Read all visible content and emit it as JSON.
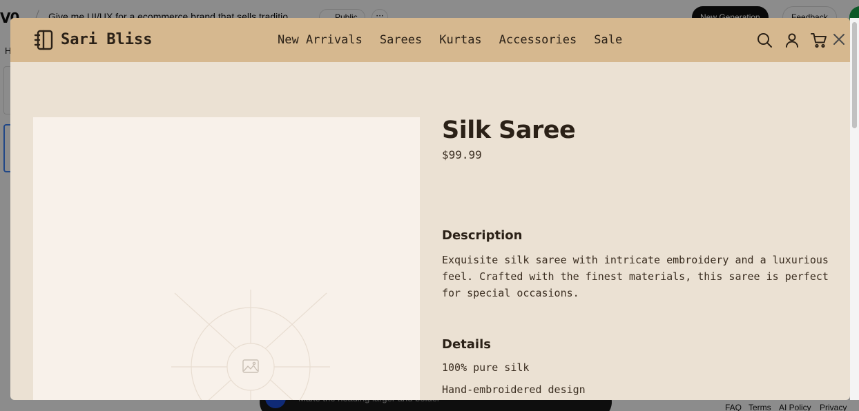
{
  "background": {
    "prompt_text": "Give me UI/UX for a ecommerce brand that sells traditio",
    "public_label": "Public",
    "more_label": "···",
    "new_generation_label": "New Generation",
    "feedback_label": "Feedback",
    "partial_text": "H",
    "chat_placeholder": "Make the heading larger and bolder",
    "footer": [
      "FAQ",
      "Terms",
      "AI Policy",
      "Privacy"
    ]
  },
  "header": {
    "brand_name": "Sari Bliss",
    "nav": [
      "New Arrivals",
      "Sarees",
      "Kurtas",
      "Accessories",
      "Sale"
    ],
    "icons": [
      "search-icon",
      "user-icon",
      "cart-icon",
      "close-icon"
    ]
  },
  "product": {
    "title": "Silk Saree",
    "price": "$99.99",
    "description_heading": "Description",
    "description": "Exquisite silk saree with intricate embroidery and a luxurious feel. Crafted with the finest materials, this saree is perfect for special occasions.",
    "details_heading": "Details",
    "details": [
      "100% pure silk",
      "Hand-embroidered design"
    ]
  },
  "colors": {
    "header_bg": "#d6b88f",
    "page_bg": "#ebe1d3",
    "image_bg": "#f8f1ea",
    "text": "#2b2117"
  }
}
